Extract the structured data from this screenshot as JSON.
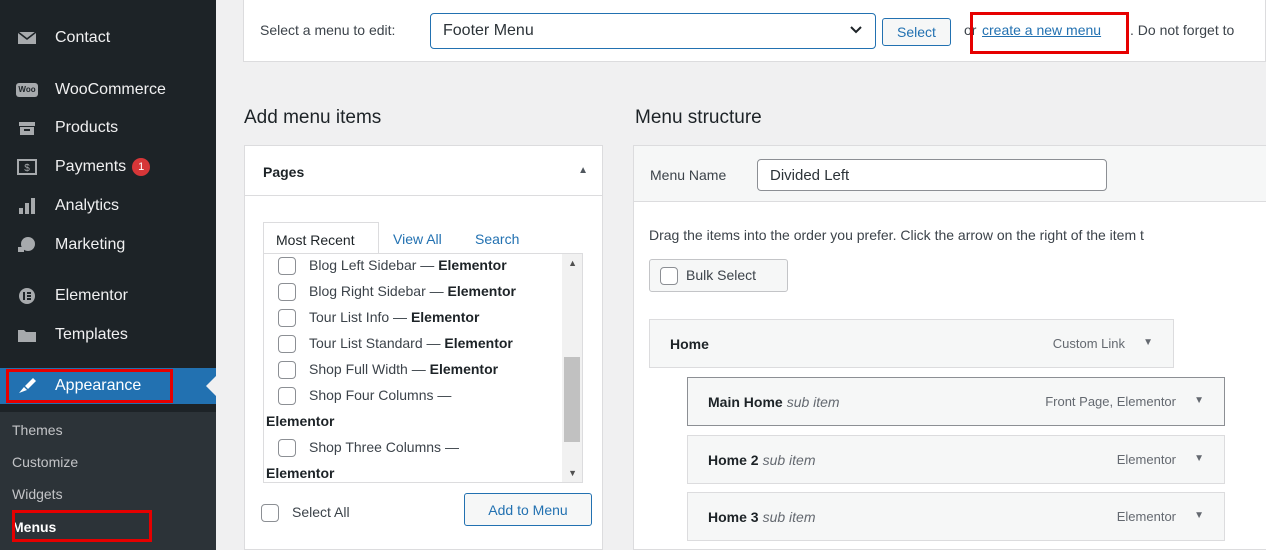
{
  "sidebar": {
    "items": [
      {
        "label": "Contact",
        "icon": "envelope-icon"
      },
      {
        "label": "WooCommerce",
        "icon": "woo-icon",
        "icon_text": "Woo"
      },
      {
        "label": "Products",
        "icon": "archive-icon"
      },
      {
        "label": "Payments",
        "icon": "money-icon",
        "badge": "1"
      },
      {
        "label": "Analytics",
        "icon": "bar-chart-icon"
      },
      {
        "label": "Marketing",
        "icon": "megaphone-icon"
      },
      {
        "label": "Elementor",
        "icon": "elementor-icon"
      },
      {
        "label": "Templates",
        "icon": "folder-icon"
      },
      {
        "label": "Appearance",
        "icon": "paintbrush-icon"
      }
    ],
    "submenu": [
      "Themes",
      "Customize",
      "Widgets",
      "Menus"
    ]
  },
  "topbar": {
    "label": "Select a menu to edit:",
    "selected_menu": "Footer Menu",
    "select_button": "Select",
    "or_text": "or",
    "create_link": "create a new menu",
    "tail_text": ". Do not forget to"
  },
  "add_items": {
    "heading": "Add menu items",
    "panel_title": "Pages",
    "tabs": [
      "Most Recent",
      "View All",
      "Search"
    ],
    "pages": [
      {
        "name": "Blog Left Sidebar",
        "builder": "Elementor"
      },
      {
        "name": "Blog Right Sidebar",
        "builder": "Elementor"
      },
      {
        "name": "Tour List Info",
        "builder": "Elementor"
      },
      {
        "name": "Tour List Standard",
        "builder": "Elementor"
      },
      {
        "name": "Shop Full Width",
        "builder": "Elementor"
      },
      {
        "name": "Shop Four Columns",
        "builder": "Elementor"
      },
      {
        "name": "Shop Three Columns",
        "builder": "Elementor"
      }
    ],
    "dash": "—",
    "select_all": "Select All",
    "add_button": "Add to Menu"
  },
  "structure": {
    "heading": "Menu structure",
    "name_label": "Menu Name",
    "name_value": "Divided Left",
    "instructions": "Drag the items into the order you prefer. Click the arrow on the right of the item t",
    "bulk_select": "Bulk Select",
    "items": [
      {
        "name": "Home",
        "sub": "",
        "type": "Custom Link"
      },
      {
        "name": "Main Home",
        "sub": "sub item",
        "type": "Front Page, Elementor"
      },
      {
        "name": "Home 2",
        "sub": "sub item",
        "type": "Elementor"
      },
      {
        "name": "Home 3",
        "sub": "sub item",
        "type": "Elementor"
      }
    ]
  },
  "colors": {
    "accent": "#2271b1",
    "sidebar_bg": "#1d2327",
    "highlight": "#e60000",
    "badge": "#d63638"
  }
}
